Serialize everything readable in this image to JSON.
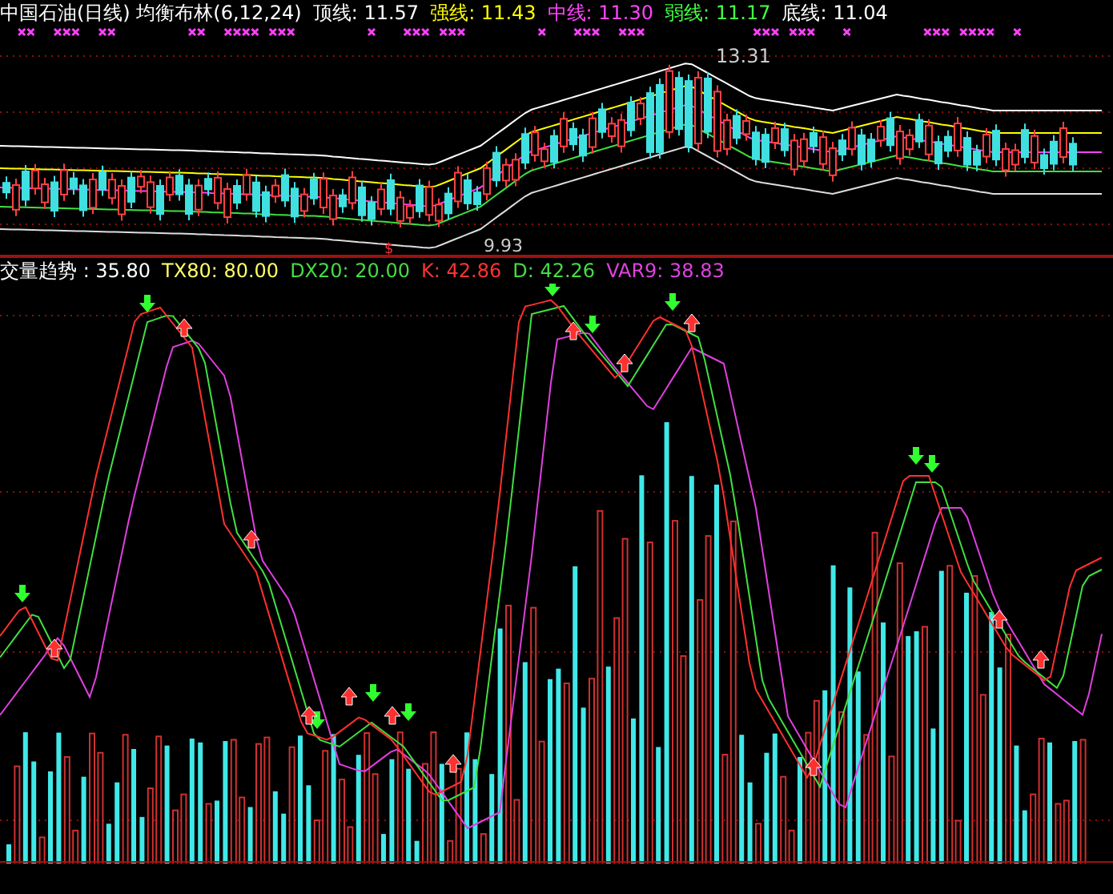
{
  "price_panel": {
    "legend": [
      {
        "text": "中国石油(日线) 均衡布林(6,12,24)",
        "color": "#ffffff"
      },
      {
        "text": "顶线: 11.57",
        "color": "#ffffff"
      },
      {
        "text": "强线: 11.43",
        "color": "#ffff00"
      },
      {
        "text": "中线: 11.30",
        "color": "#ff44ff"
      },
      {
        "text": "弱线: 11.17",
        "color": "#44ff44"
      },
      {
        "text": "底线: 11.04",
        "color": "#ffffff"
      }
    ],
    "high_label": "13.31",
    "low_label": "9.93",
    "signal_mark": "$"
  },
  "indicator_panel": {
    "legend": [
      {
        "text": "交量趋势 : 35.80",
        "color": "#ffffff"
      },
      {
        "text": "TX80: 80.00",
        "color": "#ffff66"
      },
      {
        "text": "DX20: 20.00",
        "color": "#44dd44"
      },
      {
        "text": "K: 42.86",
        "color": "#ff3333"
      },
      {
        "text": "D: 42.26",
        "color": "#44dd44"
      },
      {
        "text": "VAR9: 38.83",
        "color": "#dd44dd"
      }
    ]
  }
}
